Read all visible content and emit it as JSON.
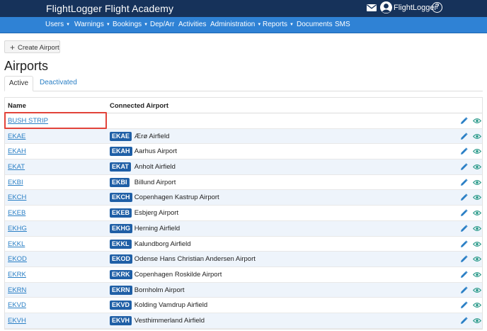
{
  "app": {
    "brand": "FlightLogger Flight Academy",
    "user_name": "FlightLogger",
    "help_label": "?"
  },
  "nav": [
    {
      "label": "Users",
      "dropdown": true
    },
    {
      "label": "Warnings",
      "dropdown": true
    },
    {
      "label": "Bookings",
      "dropdown": true
    },
    {
      "label": "Dep/Arr",
      "dropdown": false
    },
    {
      "label": "Activities",
      "dropdown": false
    },
    {
      "label": "Administration",
      "dropdown": true
    },
    {
      "label": "Reports",
      "dropdown": true
    },
    {
      "label": "Documents",
      "dropdown": false
    },
    {
      "label": "SMS",
      "dropdown": false
    }
  ],
  "toolbar": {
    "create_label": "Create Airport"
  },
  "page": {
    "title": "Airports"
  },
  "tabs": {
    "active": "Active",
    "other": "Deactivated"
  },
  "table": {
    "headers": {
      "name": "Name",
      "connected": "Connected Airport"
    },
    "rows": [
      {
        "name": "BUSH STRIP",
        "code": "",
        "airport": ""
      },
      {
        "name": "EKAE",
        "code": "EKAE",
        "airport": "Ærø Airfield"
      },
      {
        "name": "EKAH",
        "code": "EKAH",
        "airport": "Aarhus Airport"
      },
      {
        "name": "EKAT",
        "code": "EKAT",
        "airport": "Anholt Airfield"
      },
      {
        "name": "EKBI",
        "code": "EKBI",
        "airport": "Billund Airport"
      },
      {
        "name": "EKCH",
        "code": "EKCH",
        "airport": "Copenhagen Kastrup Airport"
      },
      {
        "name": "EKEB",
        "code": "EKEB",
        "airport": "Esbjerg Airport"
      },
      {
        "name": "EKHG",
        "code": "EKHG",
        "airport": "Herning Airfield"
      },
      {
        "name": "EKKL",
        "code": "EKKL",
        "airport": "Kalundborg Airfield"
      },
      {
        "name": "EKOD",
        "code": "EKOD",
        "airport": "Odense Hans Christian Andersen Airport"
      },
      {
        "name": "EKRK",
        "code": "EKRK",
        "airport": "Copenhagen Roskilde Airport"
      },
      {
        "name": "EKRN",
        "code": "EKRN",
        "airport": "Bornholm Airport"
      },
      {
        "name": "EKVD",
        "code": "EKVD",
        "airport": "Kolding Vamdrup Airfield"
      },
      {
        "name": "EKVH",
        "code": "EKVH",
        "airport": "Vesthimmerland Airfield"
      }
    ]
  },
  "colors": {
    "topbar": "#16325a",
    "navbar": "#2f82d5",
    "link": "#2a7fc5",
    "badge": "#1f5fa6",
    "row_alt": "#eef4fb",
    "highlight": "#e2433a"
  },
  "icons": {
    "mail": "envelope-icon",
    "avatar": "user-avatar-icon",
    "help": "help-icon",
    "create": "plus-icon",
    "edit": "pencil-icon",
    "view": "eye-icon"
  }
}
